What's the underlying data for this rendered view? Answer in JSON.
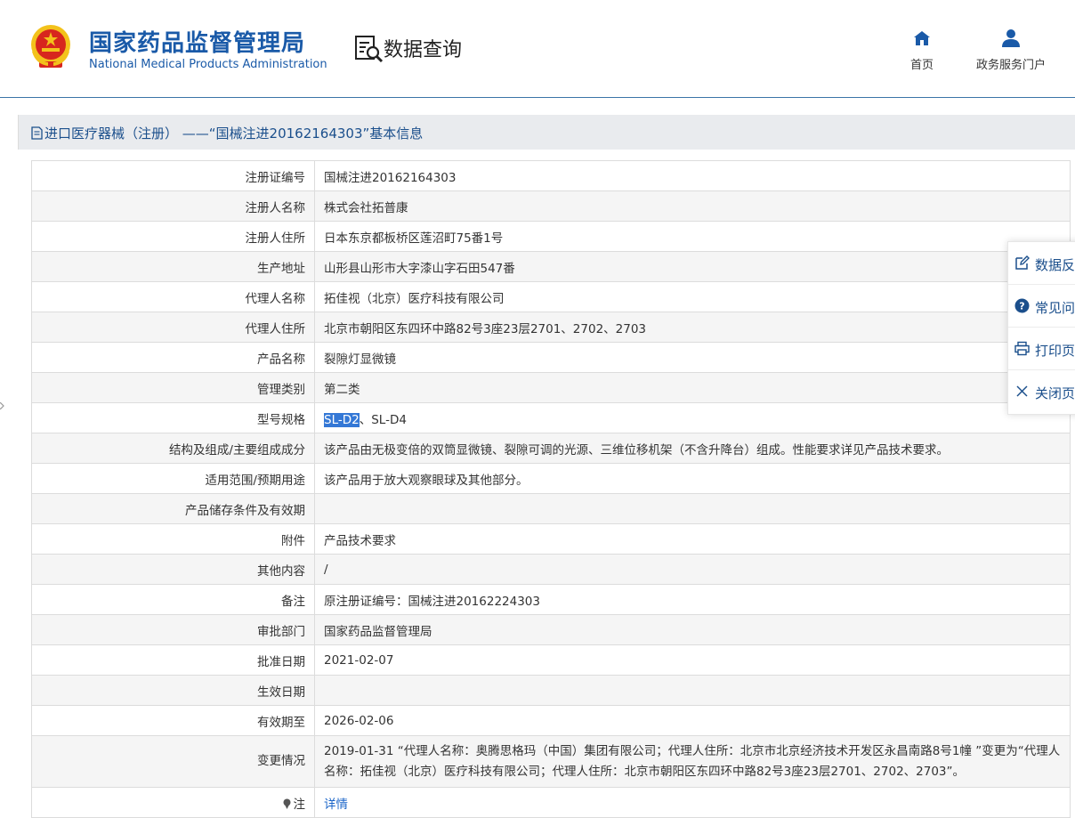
{
  "header": {
    "org_cn": "国家药品监督管理局",
    "org_en": "National Medical Products Administration",
    "query_title": "数据查询",
    "nav": {
      "home": "首页",
      "portal": "政务服务门户"
    }
  },
  "section": {
    "title": "进口医疗器械（注册） ——“国械注进20162164303”基本信息"
  },
  "rows": [
    {
      "label": "注册证编号",
      "value": "国械注进20162164303"
    },
    {
      "label": "注册人名称",
      "value": "株式会社拓普康"
    },
    {
      "label": "注册人住所",
      "value": "日本东京都板桥区莲沼町75番1号"
    },
    {
      "label": "生产地址",
      "value": "山形县山形市大字漆山字石田547番"
    },
    {
      "label": "代理人名称",
      "value": "拓佳视（北京）医疗科技有限公司"
    },
    {
      "label": "代理人住所",
      "value": "北京市朝阳区东四环中路82号3座23层2701、2702、2703"
    },
    {
      "label": "产品名称",
      "value": "裂隙灯显微镜"
    },
    {
      "label": "管理类别",
      "value": "第二类"
    },
    {
      "label": "型号规格",
      "value_selected": "SL-D2",
      "value_rest": "、SL-D4"
    },
    {
      "label": "结构及组成/主要组成成分",
      "value": "该产品由无极变倍的双筒显微镜、裂隙可调的光源、三维位移机架（不含升降台）组成。性能要求详见产品技术要求。"
    },
    {
      "label": "适用范围/预期用途",
      "value": "该产品用于放大观察眼球及其他部分。"
    },
    {
      "label": "产品储存条件及有效期",
      "value": ""
    },
    {
      "label": "附件",
      "value": "产品技术要求"
    },
    {
      "label": "其他内容",
      "value": "/"
    },
    {
      "label": "备注",
      "value": "原注册证编号：国械注进20162224303"
    },
    {
      "label": "审批部门",
      "value": "国家药品监督管理局"
    },
    {
      "label": "批准日期",
      "value": "2021-02-07"
    },
    {
      "label": "生效日期",
      "value": ""
    },
    {
      "label": "有效期至",
      "value": "2026-02-06"
    },
    {
      "label": "变更情况",
      "value": "2019-01-31 “代理人名称：奥腾思格玛（中国）集团有限公司；代理人住所：北京市北京经济技术开发区永昌南路8号1幢 ”变更为“代理人名称：拓佳视（北京）医疗科技有限公司；代理人住所：北京市朝阳区东四环中路82号3座23层2701、2702、2703”。"
    },
    {
      "label": "注",
      "value": "详情"
    }
  ],
  "side_panel": {
    "feedback": "数据反",
    "faq": "常见问",
    "print": "打印页",
    "close": "关闭页"
  },
  "colors": {
    "brand_blue": "#1a5aa8",
    "emblem_red": "#d7261e",
    "emblem_gold": "#f3c21b",
    "selection": "#3478d6"
  }
}
